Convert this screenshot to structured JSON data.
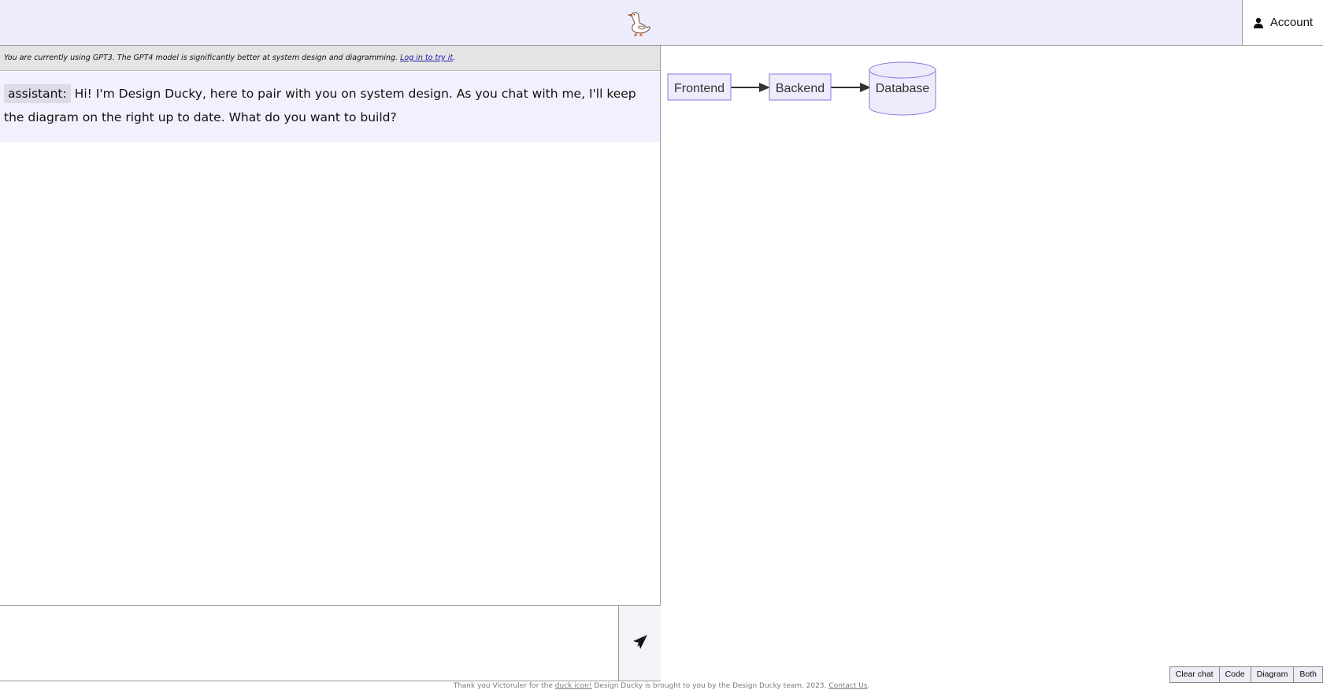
{
  "header": {
    "logo_icon": "duck-icon",
    "account_label": "Account",
    "account_icon": "user-icon"
  },
  "notice": {
    "text": "You are currently using GPT3. The GPT4 model is significantly better at system design and diagramming.",
    "link_text": "Log in to try it",
    "suffix": "."
  },
  "chat": {
    "messages": [
      {
        "role": "assistant:",
        "text": "Hi! I'm Design Ducky, here to pair with you on system design. As you chat with me, I'll keep the diagram on the right up to date. What do you want to build?"
      }
    ],
    "input_placeholder": "",
    "send_icon": "send-icon"
  },
  "diagram": {
    "nodes": [
      {
        "id": "frontend",
        "label": "Frontend",
        "shape": "rect"
      },
      {
        "id": "backend",
        "label": "Backend",
        "shape": "rect"
      },
      {
        "id": "database",
        "label": "Database",
        "shape": "cylinder"
      }
    ],
    "edges": [
      {
        "from": "frontend",
        "to": "backend"
      },
      {
        "from": "backend",
        "to": "database"
      }
    ],
    "node_fill": "#ececfd",
    "node_stroke": "#9370db"
  },
  "view_buttons": {
    "clear_chat": "Clear chat",
    "code": "Code",
    "diagram": "Diagram",
    "both": "Both"
  },
  "footer": {
    "thanks_prefix": "Thank you Victoruler for the",
    "duck_link": "duck icon!",
    "brought_by": "Design Ducky is brought to you by the Design Ducky team. 2023.",
    "contact_link": "Contact Us",
    "end": "."
  }
}
